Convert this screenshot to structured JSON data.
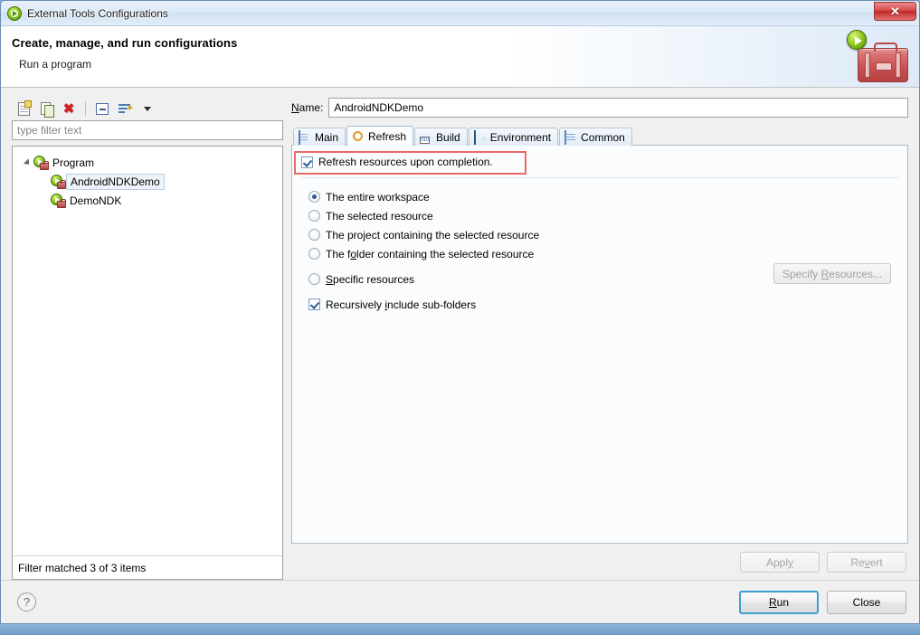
{
  "window": {
    "title": "External Tools Configurations",
    "title_icon": "run-green-icon",
    "close_label": "✕"
  },
  "header": {
    "title": "Create, manage, and run configurations",
    "subtitle": "Run a program",
    "art_icon": "toolbox-with-run-badge-icon"
  },
  "left_panel": {
    "toolbar": [
      {
        "name": "new-configuration-icon",
        "tooltip": "New launch configuration"
      },
      {
        "name": "duplicate-configuration-icon",
        "tooltip": "Duplicate"
      },
      {
        "name": "delete-configuration-icon",
        "tooltip": "Delete"
      },
      {
        "name": "collapse-all-icon",
        "tooltip": "Collapse All"
      },
      {
        "name": "filter-icon",
        "tooltip": "Filter launch configurations"
      },
      {
        "name": "chevron-down-icon",
        "tooltip": "Menu"
      }
    ],
    "filter": {
      "placeholder": "type filter text",
      "value": ""
    },
    "tree": [
      {
        "label": "Program",
        "level": 0,
        "expanded": true,
        "selected": false
      },
      {
        "label": "AndroidNDKDemo",
        "level": 1,
        "expanded": false,
        "selected": true
      },
      {
        "label": "DemoNDK",
        "level": 1,
        "expanded": false,
        "selected": false
      }
    ],
    "status": "Filter matched 3 of 3 items"
  },
  "right_panel": {
    "name_label_pre": "N",
    "name_label_post": "ame:",
    "name_value": "AndroidNDKDemo",
    "name_placeholder": "",
    "tabs": [
      {
        "label": "Main",
        "icon": "main-tab-icon",
        "active": false
      },
      {
        "label": "Refresh",
        "icon": "refresh-tab-icon",
        "active": true
      },
      {
        "label": "Build",
        "icon": "build-tab-icon",
        "active": false
      },
      {
        "label": "Environment",
        "icon": "environment-tab-icon",
        "active": false
      },
      {
        "label": "Common",
        "icon": "common-tab-icon",
        "active": false
      }
    ],
    "refresh_tab": {
      "enable_checkbox": {
        "label": "Refresh resources upon completion.",
        "checked": true,
        "annotated": true
      },
      "scope_options": [
        {
          "label_pre": "The entire workspace",
          "mnemonic": "",
          "label_post": "",
          "selected": true
        },
        {
          "label_pre": "The selected resource",
          "mnemonic": "",
          "label_post": "",
          "selected": false
        },
        {
          "label_pre": "The project containing the selected resource",
          "mnemonic": "",
          "label_post": "",
          "selected": false
        },
        {
          "label_pre": "The f",
          "mnemonic": "o",
          "label_post": "lder containing the selected resource",
          "selected": false
        },
        {
          "label_pre": "",
          "mnemonic": "S",
          "label_post": "pecific resources",
          "selected": false
        }
      ],
      "specify_button": {
        "label_pre": "Specify ",
        "mnemonic": "R",
        "label_post": "esources...",
        "enabled": false
      },
      "recursive_checkbox": {
        "label_pre": "Recursively ",
        "mnemonic": "i",
        "label_post": "nclude sub-folders",
        "checked": true
      }
    },
    "apply_button": {
      "label_pre": "Appl",
      "mnemonic": "y",
      "label_post": "",
      "enabled": false
    },
    "revert_button": {
      "label_pre": "Re",
      "mnemonic": "v",
      "label_post": "ert",
      "enabled": false
    }
  },
  "footer": {
    "help_label": "?",
    "run_button": {
      "label_pre": "",
      "mnemonic": "R",
      "label_post": "un"
    },
    "close_button": {
      "label": "Close"
    }
  },
  "colors": {
    "annotation_red": "#e86a6a",
    "focus_blue": "#3c9fd0",
    "selection_blue": "#eef3f9",
    "desktop_blue": "#7ba7d0"
  }
}
